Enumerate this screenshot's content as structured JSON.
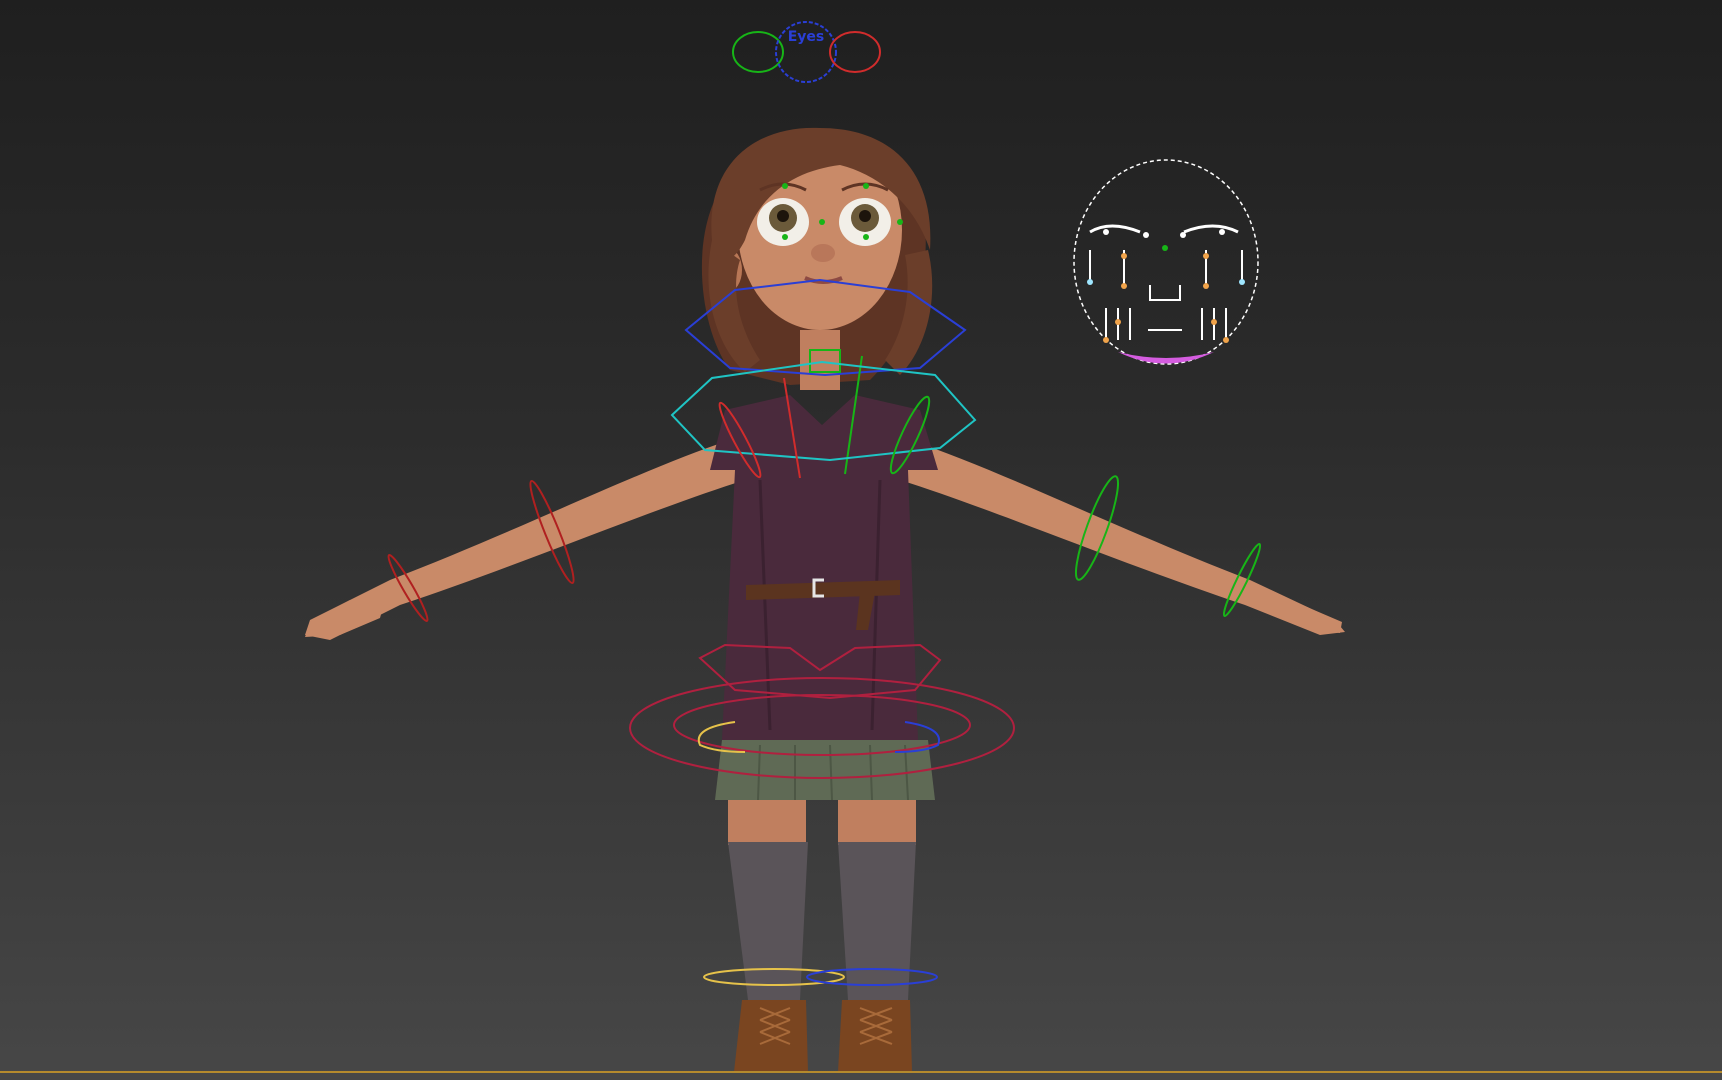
{
  "viewport": {
    "background_top": "#1f1f1f",
    "background_bottom": "#474747",
    "ground_line_color": "#b58a2d"
  },
  "rig": {
    "eyes_control_label": "Eyes",
    "eyes_control_colors": [
      "#17b517",
      "#2a3fd6",
      "#d12c2c"
    ],
    "face_panel_outline_color": "#ffffff",
    "face_panel_mouth_color": "#d55ce0"
  },
  "character": {
    "skin": "#c98a68",
    "hair": "#6b3e2a",
    "shirt": "#4a2a3c",
    "skirt": "#5f6a55",
    "stockings": "#5a5459",
    "boots": "#7a4520",
    "belt": "#5b341f"
  }
}
